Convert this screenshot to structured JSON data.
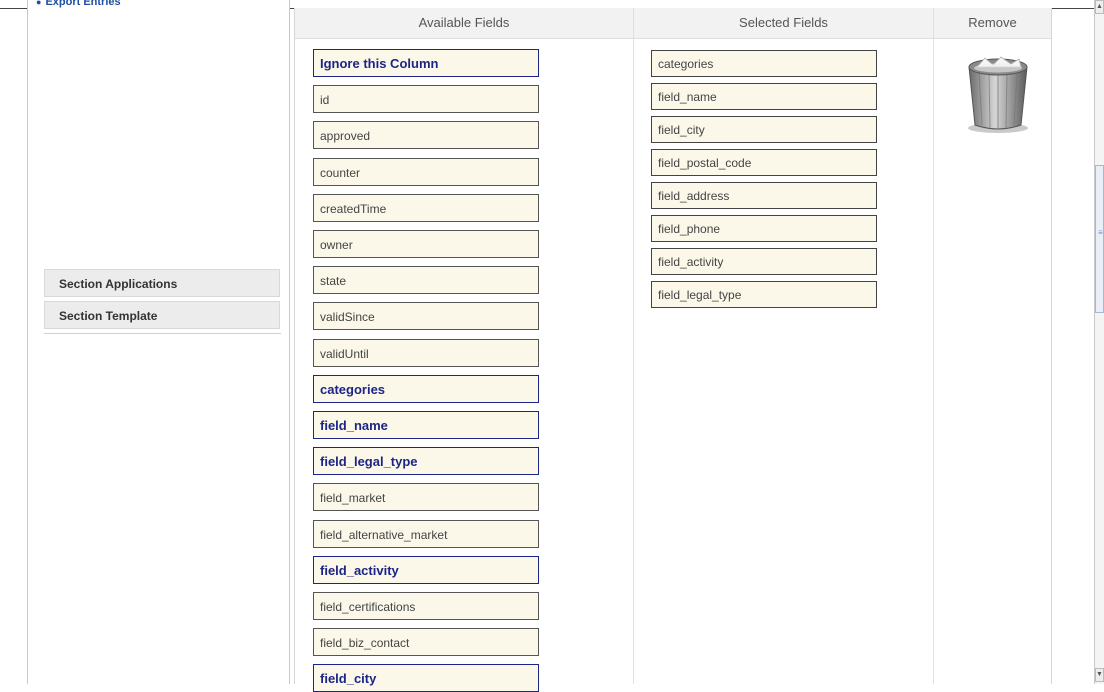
{
  "sidebar": {
    "export_link": "Export Entries",
    "sections": [
      {
        "label": "Section Applications"
      },
      {
        "label": "Section Template"
      }
    ]
  },
  "table": {
    "headers": {
      "available": "Available Fields",
      "selected": "Selected Fields",
      "remove": "Remove"
    },
    "available_fields": [
      {
        "label": "Ignore this Column",
        "bold": true
      },
      {
        "label": "id",
        "bold": false
      },
      {
        "label": "approved",
        "bold": false
      },
      {
        "label": "counter",
        "bold": false
      },
      {
        "label": "createdTime",
        "bold": false
      },
      {
        "label": "owner",
        "bold": false
      },
      {
        "label": "state",
        "bold": false
      },
      {
        "label": "validSince",
        "bold": false
      },
      {
        "label": "validUntil",
        "bold": false
      },
      {
        "label": "categories",
        "bold": true
      },
      {
        "label": "field_name",
        "bold": true
      },
      {
        "label": "field_legal_type",
        "bold": true
      },
      {
        "label": "field_market",
        "bold": false
      },
      {
        "label": "field_alternative_market",
        "bold": false
      },
      {
        "label": "field_activity",
        "bold": true
      },
      {
        "label": "field_certifications",
        "bold": false
      },
      {
        "label": "field_biz_contact",
        "bold": false
      },
      {
        "label": "field_city",
        "bold": true
      }
    ],
    "selected_fields": [
      {
        "label": "categories"
      },
      {
        "label": "field_name"
      },
      {
        "label": "field_city"
      },
      {
        "label": "field_postal_code"
      },
      {
        "label": "field_address"
      },
      {
        "label": "field_phone"
      },
      {
        "label": "field_activity"
      },
      {
        "label": "field_legal_type"
      }
    ],
    "remove_icon": "trash-icon"
  },
  "scrollbar": {
    "up_icon": "▲",
    "down_icon": "▼",
    "grip": "≡"
  }
}
